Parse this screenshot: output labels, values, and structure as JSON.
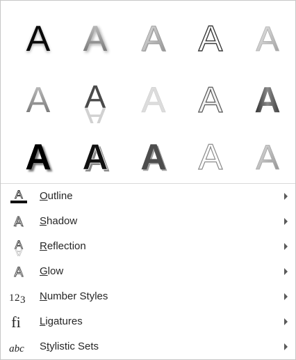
{
  "gallery": {
    "glyph": "A",
    "rows": [
      [
        {
          "name": "fill-black-glow"
        },
        {
          "name": "fill-gray-shadow"
        },
        {
          "name": "fill-gray-bevel"
        },
        {
          "name": "outline-white"
        },
        {
          "name": "fill-light-gray-gradient"
        }
      ],
      [
        {
          "name": "fill-gray-gradient"
        },
        {
          "name": "fill-dark-reflection"
        },
        {
          "name": "fill-pale-gray"
        },
        {
          "name": "outline-gray-inner"
        },
        {
          "name": "fill-dark-gradient"
        }
      ],
      [
        {
          "name": "fill-black-bold-shadow"
        },
        {
          "name": "fill-black-outline-shadow"
        },
        {
          "name": "fill-dark-bevel"
        },
        {
          "name": "outline-light"
        },
        {
          "name": "fill-gradient-bevel"
        }
      ]
    ]
  },
  "menu": {
    "items": [
      {
        "pre": "",
        "key": "O",
        "post": "utline",
        "icon": "outline-icon"
      },
      {
        "pre": "",
        "key": "S",
        "post": "hadow",
        "icon": "shadow-icon"
      },
      {
        "pre": "",
        "key": "R",
        "post": "eflection",
        "icon": "reflection-icon"
      },
      {
        "pre": "",
        "key": "G",
        "post": "low",
        "icon": "glow-icon"
      },
      {
        "pre": "",
        "key": "N",
        "post": "umber Styles",
        "icon": "number-styles-icon",
        "icon_text": "123"
      },
      {
        "pre": "",
        "key": "L",
        "post": "igatures",
        "icon": "ligatures-icon",
        "icon_text": "fi"
      },
      {
        "pre": "S",
        "key": "t",
        "post": "ylistic Sets",
        "icon": "stylistic-sets-icon",
        "icon_text": "abc"
      }
    ]
  },
  "colors": {
    "text": "#262626",
    "border": "#c6c6c6",
    "arrow": "#5a5a5a"
  }
}
